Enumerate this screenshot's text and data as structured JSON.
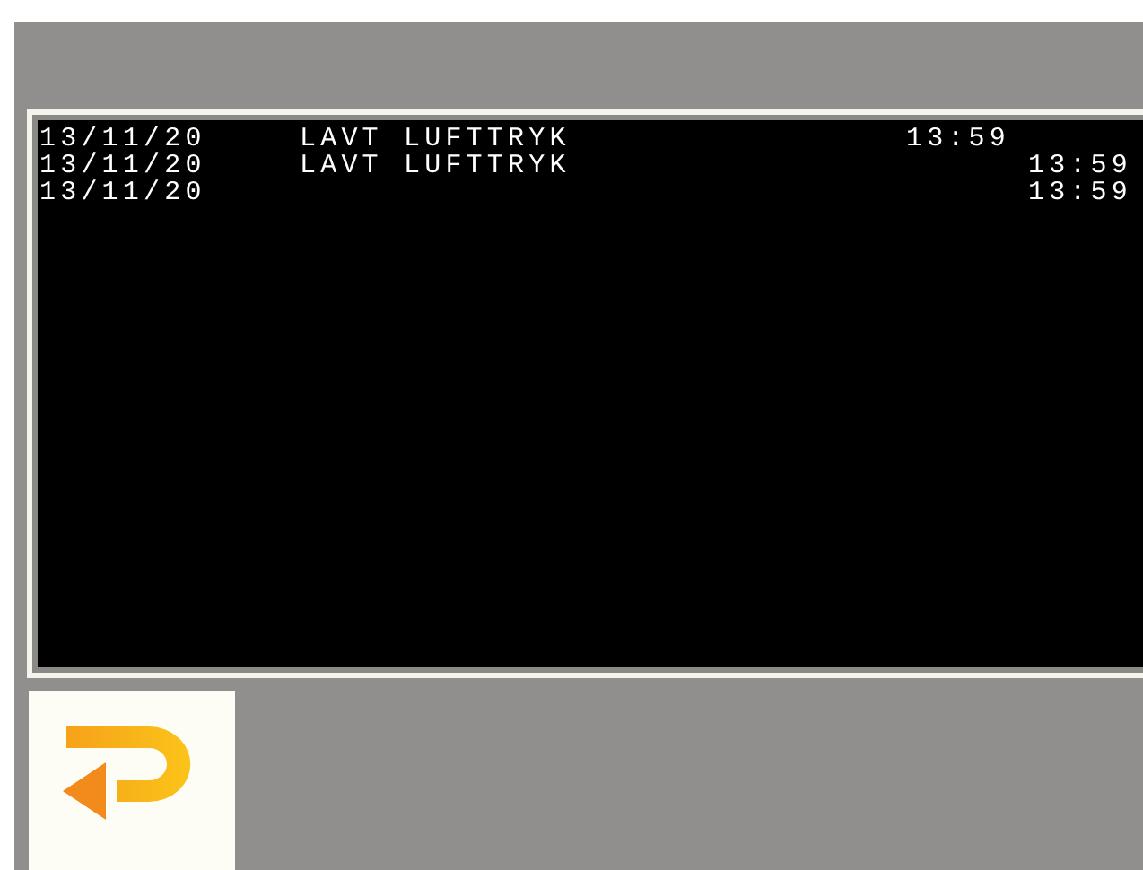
{
  "log": {
    "rows": [
      {
        "date": "13/11/20",
        "message": "LAVT LUFTTRYK",
        "time": "13:59",
        "kind": "shifted"
      },
      {
        "date": "13/11/20",
        "message": "LAVT LUFTTRYK",
        "time": "13:59",
        "kind": "aligned"
      },
      {
        "date": "13/11/20",
        "time": "13:59",
        "kind": "aligned"
      }
    ]
  },
  "back_button": {
    "kind": "return"
  }
}
